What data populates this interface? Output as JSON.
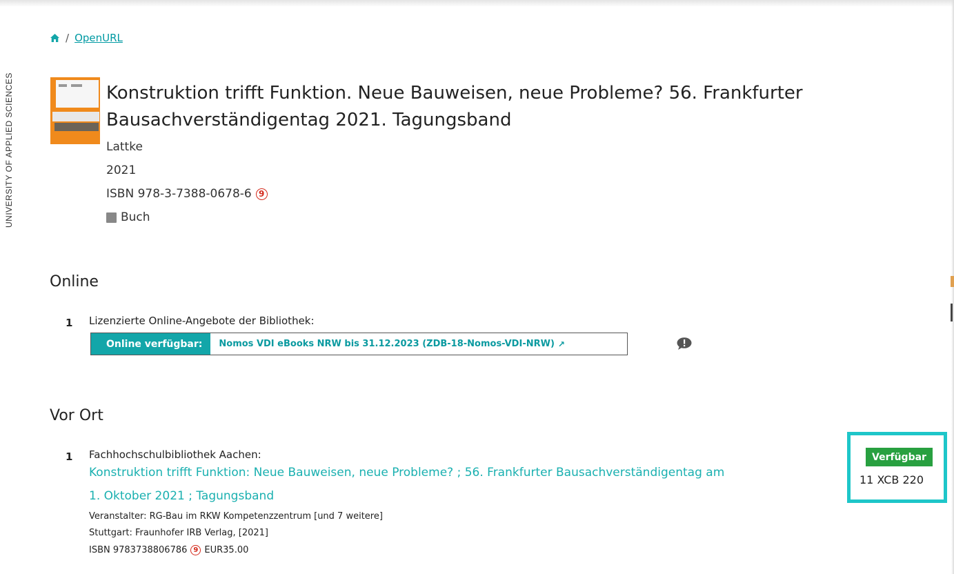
{
  "sidebar": {
    "vertical_text": "UNIVERSITY OF APPLIED SCIENCES"
  },
  "breadcrumb": {
    "separator": "/",
    "current": "OpenURL"
  },
  "record": {
    "title": "Konstruktion trifft Funktion. Neue Bauweisen, neue Probleme? 56. Frankfurter Bausachverständigentag 2021. Tagungsband",
    "author": "Lattke",
    "year": "2021",
    "isbn": "ISBN 978-3-7388-0678-6",
    "type": "Buch"
  },
  "online": {
    "heading": "Online",
    "items": [
      {
        "number": "1",
        "description": "Lizenzierte Online-Angebote der Bibliothek:",
        "status_label": "Online verfügbar:",
        "link_text": "Nomos VDI eBooks NRW bis 31.12.2023 (ZDB-18-Nomos-VDI-NRW)"
      }
    ]
  },
  "vor_ort": {
    "heading": "Vor Ort",
    "items": [
      {
        "number": "1",
        "library": "Fachhochschulbibliothek Aachen:",
        "title_line1": "Konstruktion trifft Funktion: Neue Bauweisen, neue Probleme? ; 56. Frankfurter Bausachverständigentag am",
        "title_line2": "1. Oktober 2021 ; Tagungsband",
        "organizer": "Veranstalter: RG-Bau im RKW Kompetenzzentrum [und 7 weitere]",
        "publisher": "Stuttgart: Fraunhofer IRB Verlag, [2021]",
        "isbn": "ISBN 9783738806786",
        "price": "EUR35.00",
        "availability": "Verfügbar",
        "signature": "11 XCB 220"
      }
    ]
  },
  "colors": {
    "accent": "#13a6a9",
    "available": "#28a040",
    "highlight": "#1ec6c9",
    "doi": "#d42a1c"
  }
}
